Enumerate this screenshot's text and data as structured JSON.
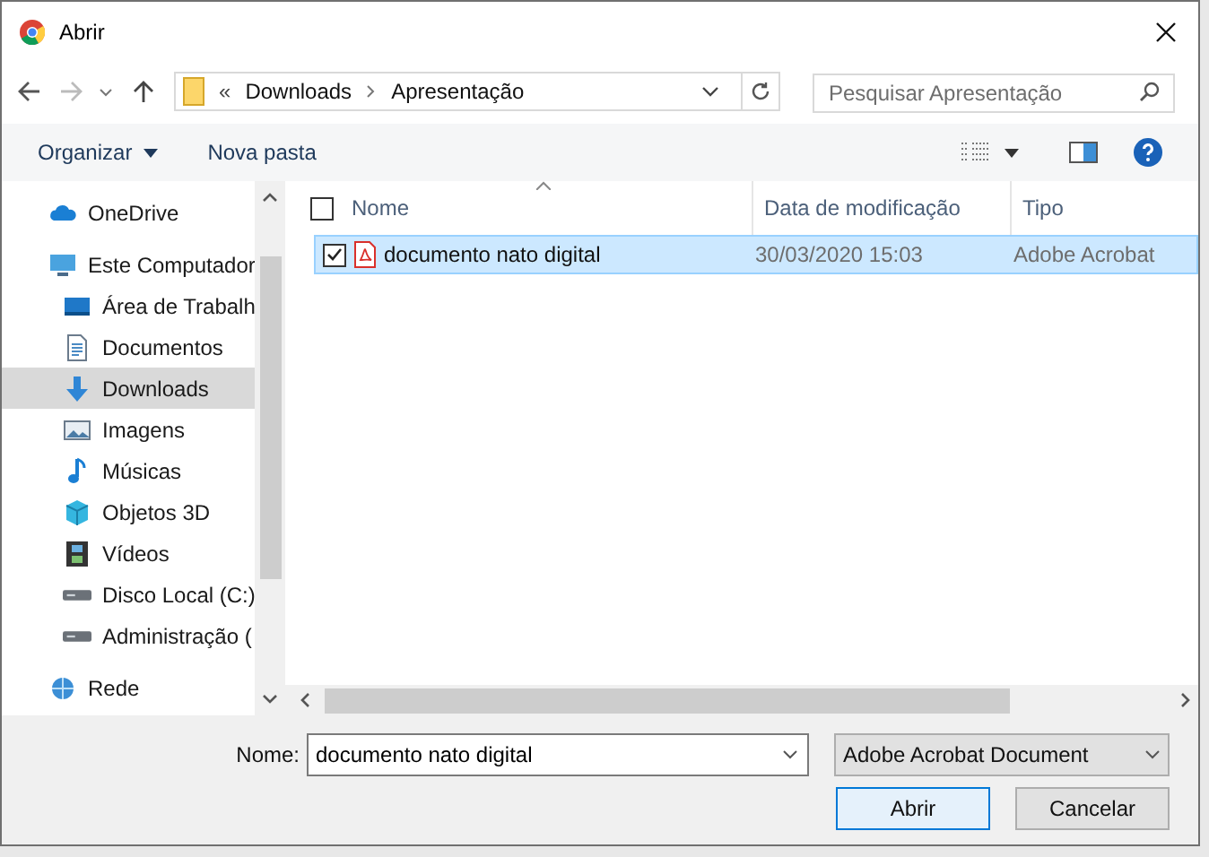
{
  "window": {
    "title": "Abrir"
  },
  "address": {
    "overflow": "«",
    "path": [
      "Downloads",
      "Apresentação"
    ]
  },
  "search": {
    "placeholder": "Pesquisar Apresentação"
  },
  "toolbar": {
    "organize": "Organizar",
    "new_folder": "Nova pasta"
  },
  "sidebar": {
    "items": [
      {
        "label": "OneDrive",
        "selected": false
      },
      {
        "label": "Este Computador",
        "selected": false,
        "children": [
          {
            "label": "Área de Trabalh",
            "selected": false
          },
          {
            "label": "Documentos",
            "selected": false
          },
          {
            "label": "Downloads",
            "selected": true
          },
          {
            "label": "Imagens",
            "selected": false
          },
          {
            "label": "Músicas",
            "selected": false
          },
          {
            "label": "Objetos 3D",
            "selected": false
          },
          {
            "label": "Vídeos",
            "selected": false
          },
          {
            "label": "Disco Local (C:)",
            "selected": false
          },
          {
            "label": "Administração (",
            "selected": false
          }
        ]
      },
      {
        "label": "Rede",
        "selected": false
      }
    ]
  },
  "table": {
    "select_all_checked": false,
    "columns": [
      "Nome",
      "Data de modificação",
      "Tipo"
    ],
    "rows": [
      {
        "name": "documento nato digital",
        "date": "30/03/2020 15:03",
        "type": "Adobe Acrobat",
        "selected": true,
        "checked": true
      }
    ]
  },
  "footer": {
    "name_label": "Nome:",
    "name_value": "documento nato digital",
    "filter": "Adobe Acrobat Document",
    "buttons": [
      {
        "label": "Abrir",
        "primary": true
      },
      {
        "label": "Cancelar",
        "primary": false
      }
    ]
  }
}
